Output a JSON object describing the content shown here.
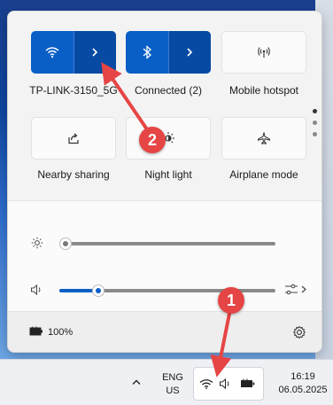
{
  "quick_settings": {
    "tiles": [
      {
        "label": "TP-LINK-3150_5G",
        "icon": "wifi-icon",
        "state": "on",
        "has_chevron": true
      },
      {
        "label": "Connected (2)",
        "icon": "bluetooth-icon",
        "state": "on",
        "has_chevron": true
      },
      {
        "label": "Mobile hotspot",
        "icon": "hotspot-icon",
        "state": "off"
      },
      {
        "label": "Nearby sharing",
        "icon": "share-icon",
        "state": "off"
      },
      {
        "label": "Night light",
        "icon": "night-light-icon",
        "state": "off"
      },
      {
        "label": "Airplane mode",
        "icon": "airplane-icon",
        "state": "off"
      }
    ],
    "brightness_level": 0.0,
    "volume_level": 0.18,
    "battery": "100%"
  },
  "taskbar": {
    "lang_line1": "ENG",
    "lang_line2": "US",
    "time": "16:19",
    "date": "06.05.2025"
  },
  "annotations": {
    "badge1": "1",
    "badge2": "2",
    "color": "#e64545"
  },
  "colors": {
    "accent": "#0a5fc6",
    "accent_dark": "#064aa3"
  }
}
